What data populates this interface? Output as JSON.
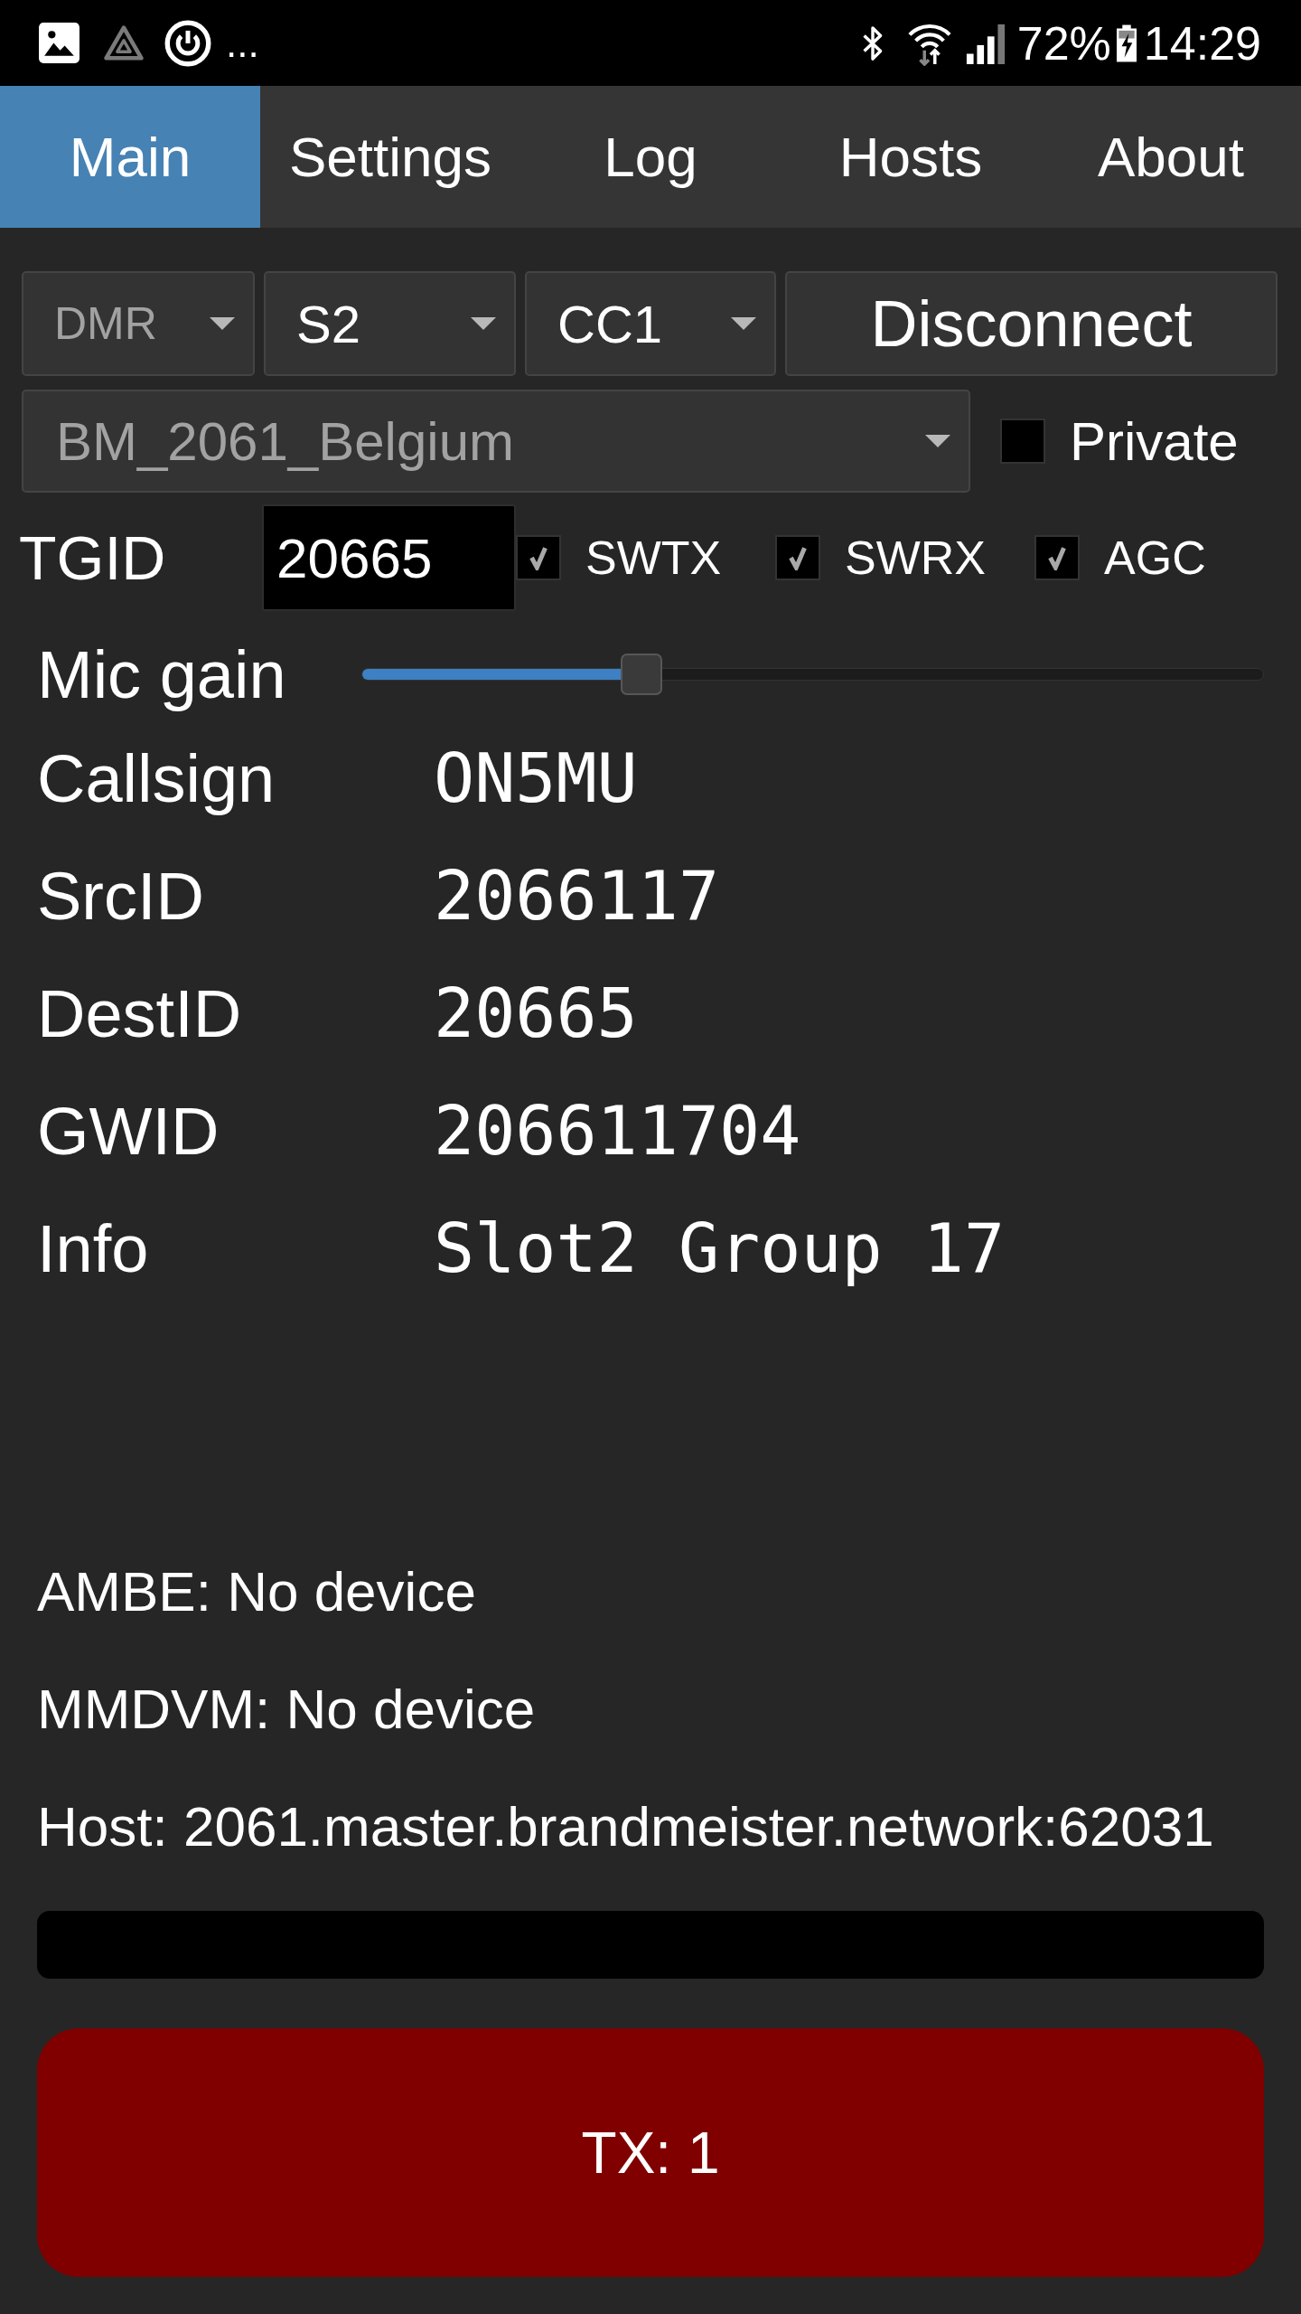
{
  "status_bar": {
    "notification_overflow": "...",
    "battery": "72%",
    "time": "14:29"
  },
  "tabs": [
    {
      "label": "Main",
      "selected": true
    },
    {
      "label": "Settings",
      "selected": false
    },
    {
      "label": "Log",
      "selected": false
    },
    {
      "label": "Hosts",
      "selected": false
    },
    {
      "label": "About",
      "selected": false
    }
  ],
  "selectors": [
    {
      "value": "DMR",
      "disabled": true
    },
    {
      "value": "S2",
      "disabled": false
    },
    {
      "value": "CC1",
      "disabled": false
    }
  ],
  "connect_button": "Disconnect",
  "host_select": {
    "value": "BM_2061_Belgium",
    "disabled": true
  },
  "private_checkbox": {
    "label": "Private",
    "checked": false
  },
  "tgid": {
    "label": "TGID",
    "value": "20665"
  },
  "options": [
    {
      "label": "SWTX",
      "checked": true
    },
    {
      "label": "SWRX",
      "checked": true
    },
    {
      "label": "AGC",
      "checked": true
    }
  ],
  "mic_gain": {
    "label": "Mic gain",
    "level": 0.31
  },
  "fields": [
    {
      "label": "Callsign",
      "value": "ON5MU"
    },
    {
      "label": "SrcID",
      "value": "2066117"
    },
    {
      "label": "DestID",
      "value": "20665"
    },
    {
      "label": "GWID",
      "value": "206611704"
    },
    {
      "label": "Info",
      "value": "Slot2 Group 17"
    }
  ],
  "status_lines": [
    "AMBE: No device",
    "MMDVM: No device",
    "Host: 2061.master.brandmeister.network:62031"
  ],
  "level_meter": {
    "level": 0
  },
  "tx_button": "TX: 1"
}
